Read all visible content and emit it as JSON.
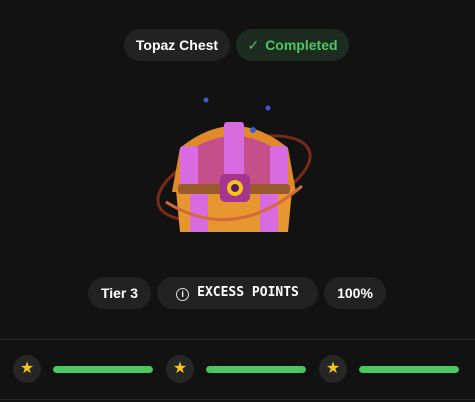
{
  "chest": {
    "title": "Topaz Chest",
    "status": "Completed",
    "status_icon": "check-icon",
    "image": "chest-illustration"
  },
  "stats": {
    "tier": "Tier 3",
    "excess_label": "EXCESS POINTS",
    "excess_icon": "info-icon",
    "percent": "100%"
  },
  "progress": {
    "star_icon": "star-icon",
    "segments": [
      {
        "fill": 1.0
      },
      {
        "fill": 1.0
      },
      {
        "fill": 1.0
      }
    ]
  },
  "colors": {
    "background": "#121212",
    "pill": "#222222",
    "success": "#4cc761",
    "star": "#f5c518"
  }
}
